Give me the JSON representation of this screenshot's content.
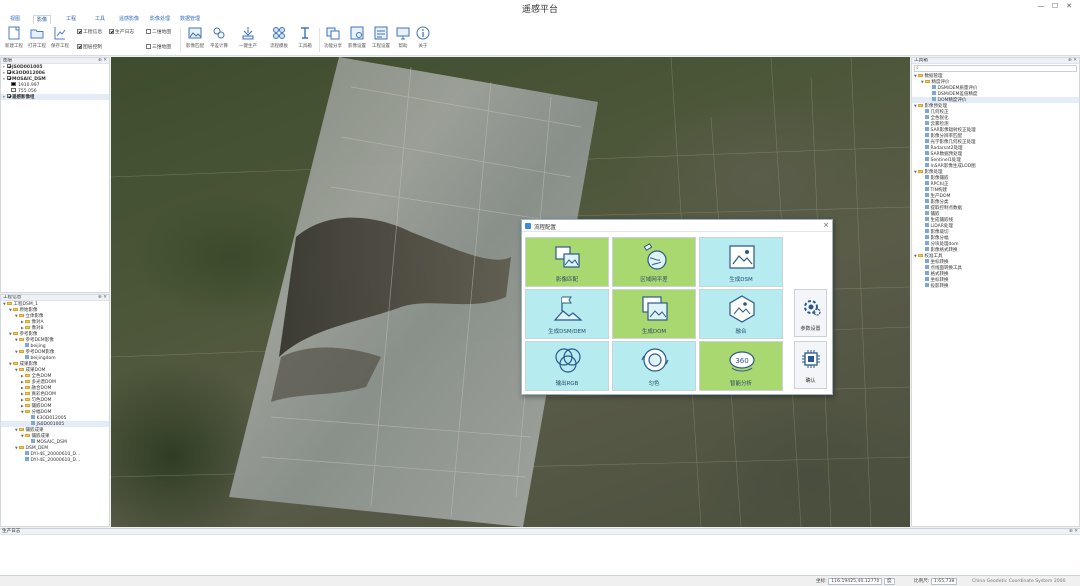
{
  "app": {
    "title": "遥感平台"
  },
  "ribbon_tabs": [
    "视图",
    "影像",
    "工程",
    "工具",
    "遥感影像",
    "影像处理",
    "数据管理"
  ],
  "ribbon_buttons": [
    {
      "label": "新建工程",
      "icon": "new-project-icon"
    },
    {
      "label": "打开工程",
      "icon": "open-project-icon"
    },
    {
      "label": "保存工程",
      "icon": "save-project-icon"
    },
    {
      "label": "影像匹配",
      "icon": "image-match-icon"
    },
    {
      "label": "平差计算",
      "icon": "adjustment-icon"
    },
    {
      "label": "一键生产",
      "icon": "one-click-produce-icon"
    },
    {
      "label": "流程模板",
      "icon": "workflow-template-icon"
    },
    {
      "label": "工具箱",
      "icon": "toolbox-icon"
    },
    {
      "label": "功能分享",
      "icon": "share-icon"
    },
    {
      "label": "影像设置",
      "icon": "image-settings-icon"
    },
    {
      "label": "工程设置",
      "icon": "project-settings-icon"
    },
    {
      "label": "帮助",
      "icon": "help-icon"
    },
    {
      "label": "关于",
      "icon": "about-icon"
    }
  ],
  "ribbon_checks": [
    {
      "label": "工程信息",
      "checked": true
    },
    {
      "label": "生产日志",
      "checked": true
    },
    {
      "label": "图层控制",
      "checked": true
    },
    {
      "label": "二维地图",
      "checked": false
    },
    {
      "label": "三维地图",
      "checked": false
    }
  ],
  "layers_panel": {
    "title": "图层",
    "items": [
      {
        "label": "JS0D001005",
        "checked": true,
        "level": 0
      },
      {
        "label": "K3OD012006",
        "checked": true,
        "level": 0
      },
      {
        "label": "MOSAIC_DSM",
        "checked": true,
        "level": 0
      },
      {
        "label": "1910.997",
        "level": 1,
        "swatch": "black"
      },
      {
        "label": "755.056",
        "level": 1,
        "swatch": "white"
      },
      {
        "label": "遥感影像组",
        "checked": true,
        "level": 0,
        "selected": true
      }
    ]
  },
  "project_panel": {
    "title": "工程信息",
    "items": [
      {
        "label": "工程DSM_1",
        "level": 0,
        "type": "folder",
        "open": true
      },
      {
        "label": "原始影像",
        "level": 1,
        "type": "folder",
        "open": true
      },
      {
        "label": "立体影像",
        "level": 2,
        "type": "folder",
        "open": true
      },
      {
        "label": "像对A",
        "level": 3,
        "type": "folder"
      },
      {
        "label": "像对B",
        "level": 3,
        "type": "folder"
      },
      {
        "label": "参考影像",
        "level": 1,
        "type": "folder",
        "open": true
      },
      {
        "label": "参考DEM影像",
        "level": 2,
        "type": "folder",
        "open": true
      },
      {
        "label": "beijing",
        "level": 3,
        "type": "doc"
      },
      {
        "label": "参考DOM影像",
        "level": 2,
        "type": "folder",
        "open": true
      },
      {
        "label": "beijingdom",
        "level": 3,
        "type": "doc"
      },
      {
        "label": "成果影像",
        "level": 1,
        "type": "folder",
        "open": true
      },
      {
        "label": "成果DOM",
        "level": 2,
        "type": "folder",
        "open": true
      },
      {
        "label": "全色DOM",
        "level": 3,
        "type": "folder"
      },
      {
        "label": "多光谱DOM",
        "level": 3,
        "type": "folder"
      },
      {
        "label": "融合DOM",
        "level": 3,
        "type": "folder"
      },
      {
        "label": "真彩色DOM",
        "level": 3,
        "type": "folder"
      },
      {
        "label": "匀色DOM",
        "level": 3,
        "type": "folder"
      },
      {
        "label": "镶嵌DOM",
        "level": 3,
        "type": "folder"
      },
      {
        "label": "分幅DOM",
        "level": 3,
        "type": "folder",
        "open": true
      },
      {
        "label": "K3OD012005",
        "level": 4,
        "type": "doc"
      },
      {
        "label": "JS0D001005",
        "level": 4,
        "type": "doc",
        "selected": true
      },
      {
        "label": "镶嵌成果",
        "level": 2,
        "type": "folder",
        "open": true
      },
      {
        "label": "镶嵌成果",
        "level": 3,
        "type": "folder",
        "open": true
      },
      {
        "label": "MOSAIC_DSM",
        "level": 4,
        "type": "doc"
      },
      {
        "label": "DSM_DEM",
        "level": 2,
        "type": "folder",
        "open": true
      },
      {
        "label": "DYI-4E_20000610_D...",
        "level": 3,
        "type": "doc"
      },
      {
        "label": "DYI-4E_20000610_D...",
        "level": 3,
        "type": "doc"
      }
    ]
  },
  "toolbox_panel": {
    "title": "工具箱",
    "items": [
      {
        "label": "数据管理",
        "level": 0,
        "type": "folder",
        "open": true
      },
      {
        "label": "精度评价",
        "level": 1,
        "type": "folder",
        "open": true
      },
      {
        "label": "DSM/DEM质量评价",
        "level": 2,
        "type": "doc"
      },
      {
        "label": "DSM/DEM差值精度",
        "level": 2,
        "type": "doc"
      },
      {
        "label": "DOM精度评价",
        "level": 2,
        "type": "doc",
        "selected": true
      },
      {
        "label": "影像预处理",
        "level": 0,
        "type": "folder",
        "open": true
      },
      {
        "label": "几何校正",
        "level": 1,
        "type": "doc"
      },
      {
        "label": "全色锐化",
        "level": 1,
        "type": "doc"
      },
      {
        "label": "云雾检测",
        "level": 1,
        "type": "doc"
      },
      {
        "label": "SAR影像辐射校正处理",
        "level": 1,
        "type": "doc"
      },
      {
        "label": "影像分辨率匹配",
        "level": 1,
        "type": "doc"
      },
      {
        "label": "光学影像几何校正处理",
        "level": 1,
        "type": "doc"
      },
      {
        "label": "Radarsat2处理",
        "level": 1,
        "type": "doc"
      },
      {
        "label": "SAR数据预处理",
        "level": 1,
        "type": "doc"
      },
      {
        "label": "Sentinel1处理",
        "level": 1,
        "type": "doc"
      },
      {
        "label": "InSAR影像生成LOD图",
        "level": 1,
        "type": "doc"
      },
      {
        "label": "影像处理",
        "level": 0,
        "type": "folder",
        "open": true
      },
      {
        "label": "影像镶嵌",
        "level": 1,
        "type": "doc"
      },
      {
        "label": "RPC纠正",
        "level": 1,
        "type": "doc"
      },
      {
        "label": "TIN构建",
        "level": 1,
        "type": "doc"
      },
      {
        "label": "生产DOM",
        "level": 1,
        "type": "doc"
      },
      {
        "label": "影像分类",
        "level": 1,
        "type": "doc"
      },
      {
        "label": "提取控制点数据",
        "level": 1,
        "type": "doc"
      },
      {
        "label": "镶嵌",
        "level": 1,
        "type": "doc"
      },
      {
        "label": "生成镶嵌线",
        "level": 1,
        "type": "doc"
      },
      {
        "label": "LiDAR处理",
        "level": 1,
        "type": "doc"
      },
      {
        "label": "影像裁切",
        "level": 1,
        "type": "doc"
      },
      {
        "label": "影像分幅",
        "level": 1,
        "type": "doc"
      },
      {
        "label": "分块处理dom",
        "level": 1,
        "type": "doc"
      },
      {
        "label": "影像格式转换",
        "level": 1,
        "type": "doc"
      },
      {
        "label": "校准工具",
        "level": 0,
        "type": "folder",
        "open": true
      },
      {
        "label": "坐标转换",
        "level": 1,
        "type": "doc"
      },
      {
        "label": "点线面转换工具",
        "level": 1,
        "type": "doc"
      },
      {
        "label": "格式转换",
        "level": 1,
        "type": "doc"
      },
      {
        "label": "坐标转换",
        "level": 1,
        "type": "doc"
      },
      {
        "label": "投影转换",
        "level": 1,
        "type": "doc"
      }
    ]
  },
  "dialog": {
    "title": "流程配置",
    "close": "×",
    "tiles": [
      {
        "label": "影像匹配",
        "color": "green",
        "icon": "image-match-icon"
      },
      {
        "label": "区域网平差",
        "color": "green",
        "icon": "satellite-adjust-icon"
      },
      {
        "label": "生成DSM",
        "color": "cyan",
        "icon": "generate-dsm-icon"
      },
      {
        "label": "生成DSM/DEM",
        "color": "cyan",
        "icon": "generate-dem-icon"
      },
      {
        "label": "生成DOM",
        "color": "green",
        "icon": "generate-dom-icon"
      },
      {
        "label": "融合",
        "color": "cyan",
        "icon": "fusion-icon"
      },
      {
        "label": "输出RGB",
        "color": "cyan",
        "icon": "output-rgb-icon"
      },
      {
        "label": "匀色",
        "color": "cyan",
        "icon": "color-balance-icon"
      },
      {
        "label": "智能分析",
        "color": "green",
        "icon": "smart-analysis-icon"
      }
    ],
    "side_buttons": [
      {
        "label": "参数设置",
        "icon": "gear-icon"
      },
      {
        "label": "确认",
        "icon": "chip-icon"
      }
    ]
  },
  "log_panel": {
    "title": "生产日志"
  },
  "statusbar": {
    "coord_label": "坐标:",
    "coord_value": "116.19425,40.12770",
    "unit": "度",
    "scale_label": "比例尺:",
    "scale_value": "1:65,738",
    "crs": "China Geodetic Coordinate System 2000"
  }
}
